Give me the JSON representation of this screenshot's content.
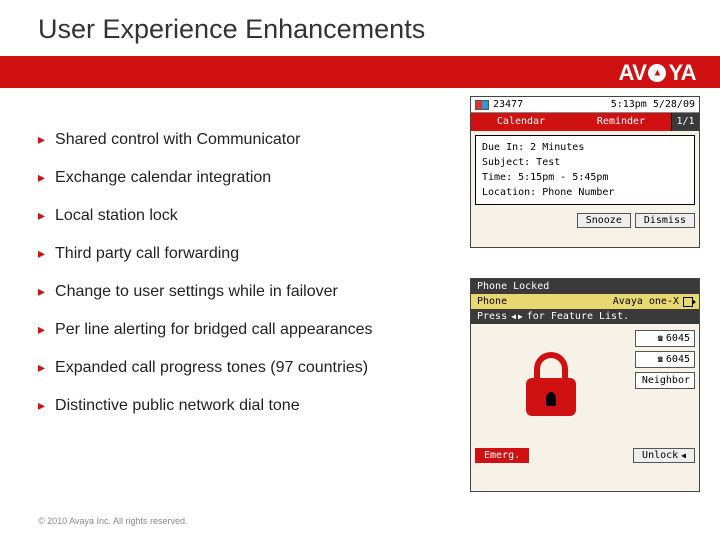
{
  "header": {
    "title": "User Experience Enhancements"
  },
  "logo": {
    "text_left": "AV",
    "text_right": "YA"
  },
  "bullets": [
    "Shared control with Communicator",
    "Exchange calendar integration",
    "Local station lock",
    "Third party call forwarding",
    "Change to user settings while in failover",
    "Per line alerting for bridged call appearances",
    "Expanded call progress tones (97 countries)",
    "Distinctive public network dial tone"
  ],
  "device_calendar": {
    "status": {
      "ext": "23477",
      "clock": "5:13pm 5/28/09"
    },
    "tabs": {
      "left": "Calendar",
      "right": "Reminder",
      "count": "1/1"
    },
    "reminder": {
      "due": "Due In: 2 Minutes",
      "subject": "Subject: Test",
      "time": "Time: 5:15pm - 5:45pm",
      "location": "Location: Phone Number"
    },
    "softkeys": {
      "snooze": "Snooze",
      "dismiss": "Dismiss"
    }
  },
  "device_locked": {
    "title": "Phone Locked",
    "appbar": {
      "left": "Phone",
      "right": "Avaya one-X"
    },
    "hint_prefix": "Press",
    "hint_suffix": "for Feature List.",
    "lines": [
      "6045",
      "6045",
      "Neighbor"
    ],
    "softkeys": {
      "emerg": "Emerg.",
      "unlock": "Unlock"
    }
  },
  "footer": "© 2010 Avaya Inc. All rights reserved."
}
